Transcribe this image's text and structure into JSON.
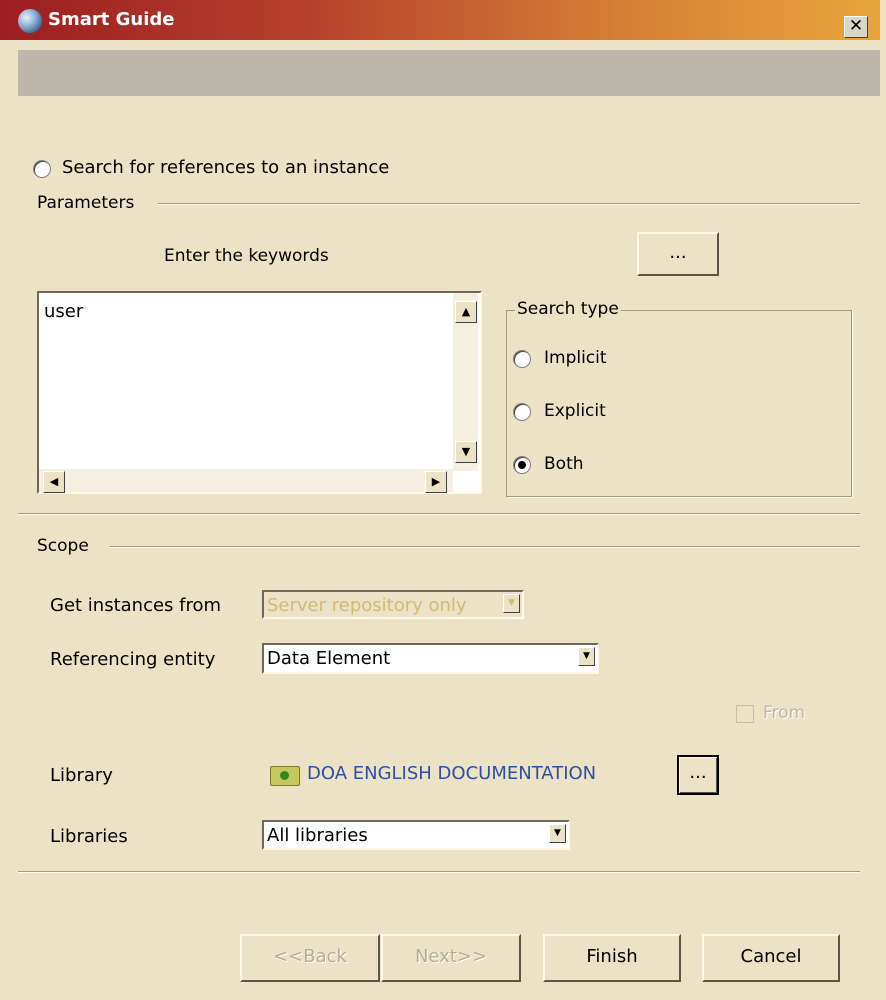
{
  "window": {
    "title": "Smart Guide",
    "close_glyph": "✕"
  },
  "search_option": {
    "label": "Search for references to an instance",
    "selected": false
  },
  "parameters": {
    "title": "Parameters",
    "keywords_label": "Enter the keywords",
    "browse_label": "...",
    "keywords_value": "user",
    "search_type": {
      "title": "Search type",
      "options": [
        {
          "label": "Implicit",
          "selected": false
        },
        {
          "label": "Explicit",
          "selected": false
        },
        {
          "label": "Both",
          "selected": true
        }
      ]
    }
  },
  "scope": {
    "title": "Scope",
    "get_instances_label": "Get instances from",
    "get_instances_value": "Server repository only",
    "referencing_label": "Referencing entity",
    "referencing_value": "Data Element",
    "from_label": "From",
    "library_label": "Library",
    "library_value": "DOA ENGLISH DOCUMENTATION",
    "library_browse_label": "...",
    "libraries_label": "Libraries",
    "libraries_value": "All libraries"
  },
  "footer": {
    "back_label": "<<Back",
    "next_label": "Next>>",
    "finish_label": "Finish",
    "cancel_label": "Cancel"
  },
  "colors": {
    "title_start": "#9c1e22",
    "title_end": "#e9a53c",
    "dialog_bg": "#ece3c6",
    "library_link": "#2f4fa0",
    "disabled_text": "#d6b87a"
  }
}
